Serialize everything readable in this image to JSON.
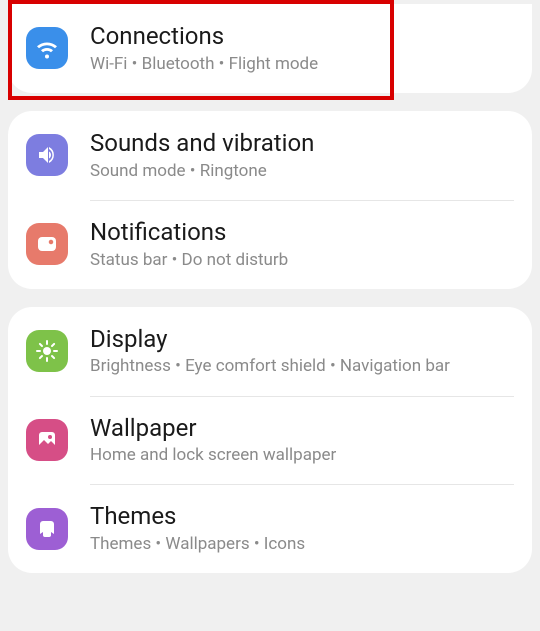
{
  "groups": [
    {
      "items": [
        {
          "key": "connections",
          "title": "Connections",
          "subtitle": "Wi-Fi  •  Bluetooth  •  Flight mode",
          "iconColor": "#3a8fea",
          "iconName": "wifi-icon"
        }
      ]
    },
    {
      "items": [
        {
          "key": "sounds",
          "title": "Sounds and vibration",
          "subtitle": "Sound mode  •  Ringtone",
          "iconColor": "#7d7de0",
          "iconName": "sound-icon"
        },
        {
          "key": "notifications",
          "title": "Notifications",
          "subtitle": "Status bar  •  Do not disturb",
          "iconColor": "#e77a6b",
          "iconName": "notifications-icon"
        }
      ]
    },
    {
      "items": [
        {
          "key": "display",
          "title": "Display",
          "subtitle": "Brightness  •  Eye comfort shield  •  Navigation bar",
          "iconColor": "#7ec249",
          "iconName": "display-icon"
        },
        {
          "key": "wallpaper",
          "title": "Wallpaper",
          "subtitle": "Home and lock screen wallpaper",
          "iconColor": "#d64e86",
          "iconName": "wallpaper-icon"
        },
        {
          "key": "themes",
          "title": "Themes",
          "subtitle": "Themes  •  Wallpapers  •  Icons",
          "iconColor": "#9d5fd4",
          "iconName": "themes-icon"
        }
      ]
    }
  ]
}
